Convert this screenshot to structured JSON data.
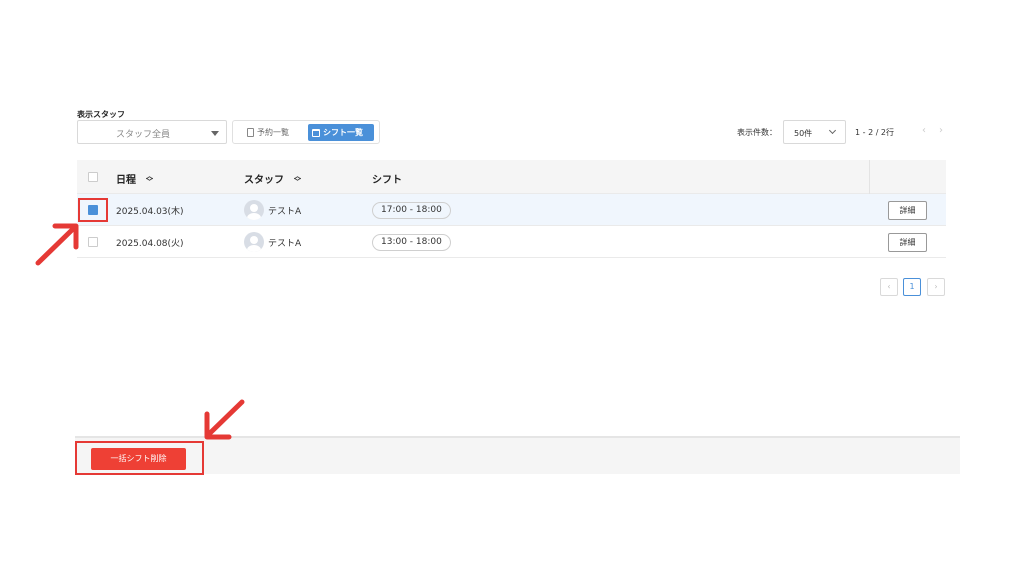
{
  "filters": {
    "staff_label": "表示スタッフ",
    "staff_select_value": "スタッフ全員",
    "view_toggle": {
      "reservation_list": "予約一覧",
      "shift_list": "シフト一覧"
    }
  },
  "pagination_top": {
    "per_page_label": "表示件数：",
    "per_page_value": "50件",
    "range_text": "1 - 2 / 2行",
    "prev_arrow": "‹",
    "next_arrow": "›"
  },
  "table": {
    "headers": {
      "date": "日程",
      "staff": "スタッフ",
      "shift": "シフト"
    },
    "rows": [
      {
        "date": "2025.04.03(木)",
        "staff": "テストA",
        "shift": "17:00 - 18:00",
        "detail": "詳細",
        "checked": true
      },
      {
        "date": "2025.04.08(火)",
        "staff": "テストA",
        "shift": "13:00 - 18:00",
        "detail": "詳細",
        "checked": false
      }
    ]
  },
  "pagination_bottom": {
    "prev": "‹",
    "current_page": "1",
    "next": "›"
  },
  "footer": {
    "bulk_delete_label": "一括シフト削除"
  },
  "colors": {
    "accent": "#4a90d9",
    "danger": "#ee4035",
    "annotation": "#e53935"
  },
  "icons": {
    "caret": "caret-down-icon",
    "sort": "sort-icon",
    "document": "document-icon",
    "calendar": "calendar-icon",
    "avatar": "user-avatar-icon"
  }
}
